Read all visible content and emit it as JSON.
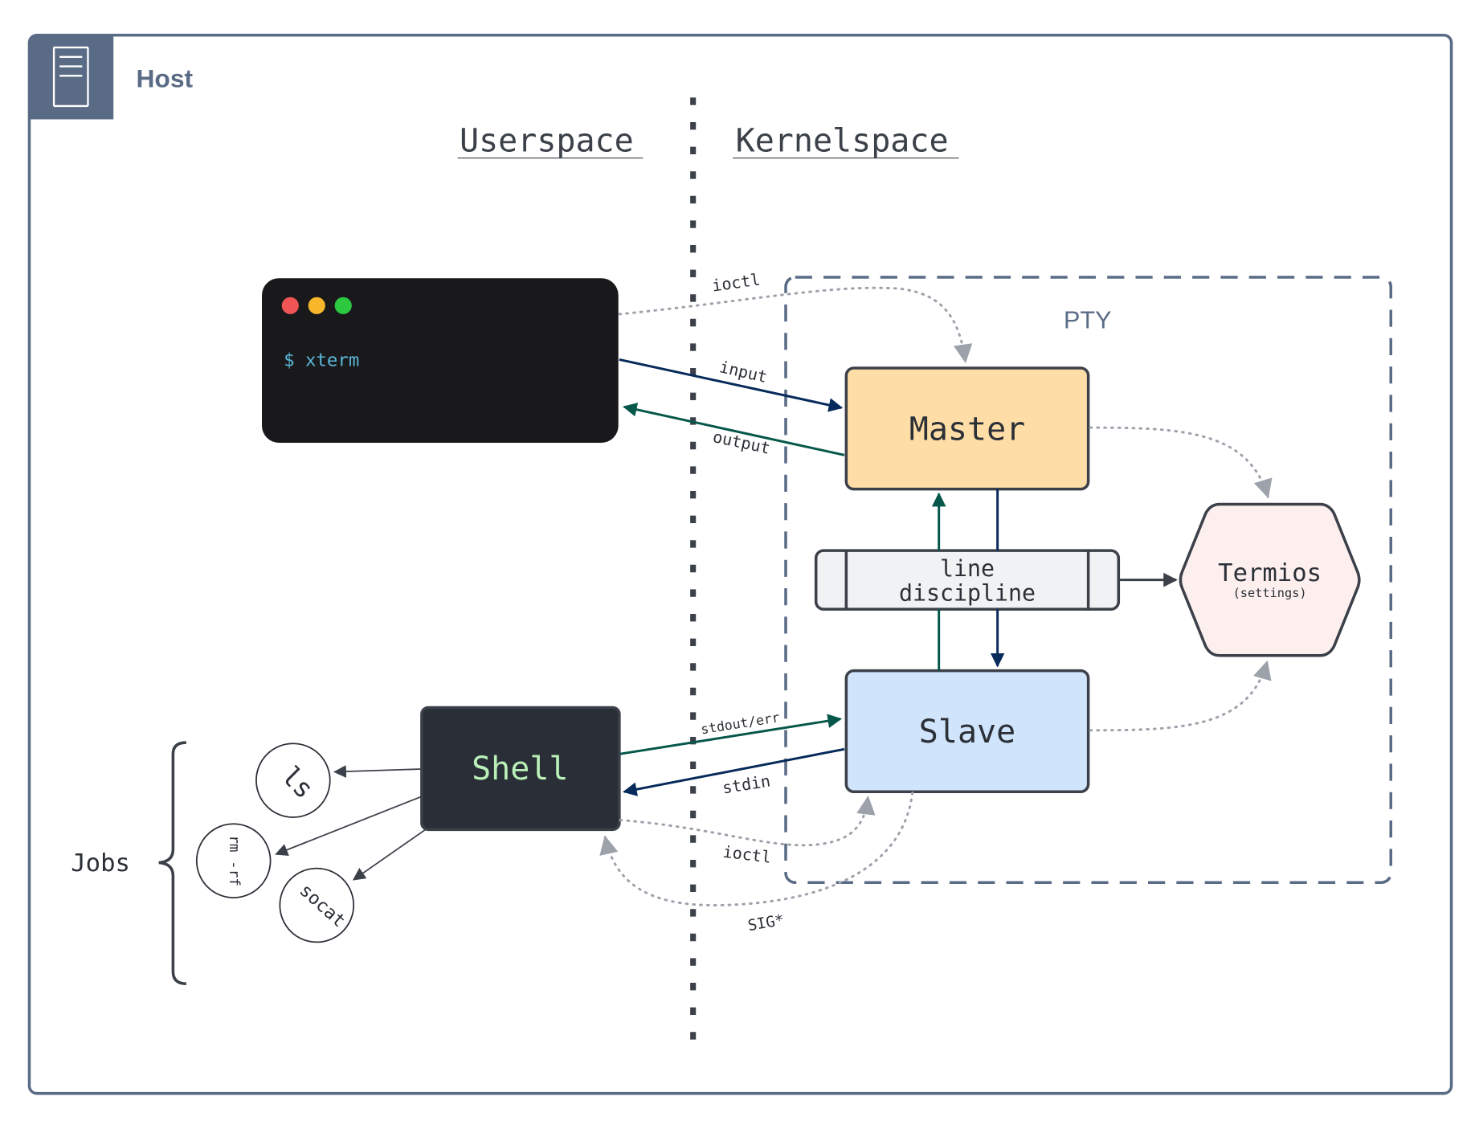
{
  "host": {
    "title": "Host",
    "icon": "server-icon"
  },
  "sections": {
    "userspace": "Userspace",
    "kernelspace": "Kernelspace"
  },
  "terminal": {
    "prompt": "$ xterm",
    "dots": [
      "#f05454",
      "#f8b62a",
      "#2bc840"
    ]
  },
  "pty": {
    "label": "PTY"
  },
  "master": {
    "label": "Master",
    "fill": "#fedea6"
  },
  "slave": {
    "label": "Slave",
    "fill": "#d0e4fb"
  },
  "line_discipline": {
    "line1": "line",
    "line2": "discipline",
    "fill": "#f1f2f3"
  },
  "termios": {
    "label": "Termios",
    "sub": "(settings)",
    "fill": "#fcefee"
  },
  "shell": {
    "label": "Shell",
    "text_color": "#b9f0b8"
  },
  "jobs": {
    "label": "Jobs",
    "items": [
      "ls",
      "rm -rf",
      "socat"
    ]
  },
  "edges": {
    "ioctl_top": "ioctl",
    "input": "input",
    "output": "output",
    "stdout_err": "stdout/err",
    "stdin": "stdin",
    "ioctl_bottom": "ioctl",
    "sig": "SIG*"
  },
  "colors": {
    "frame": "#5a6b85",
    "dark": "#3b4049",
    "navy": "#062a5a",
    "green": "#05574a",
    "gray": "#9ca1aa"
  }
}
